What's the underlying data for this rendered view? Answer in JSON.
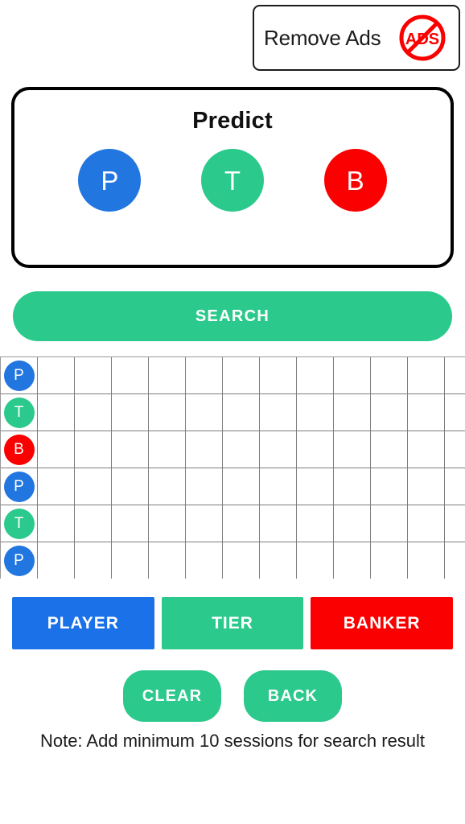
{
  "banner": {
    "label": "Remove Ads",
    "badge_icon": "no-ads-icon",
    "badge_text": "ADS",
    "badge_color": "#FB0000"
  },
  "predict": {
    "title": "Predict",
    "options": [
      {
        "letter": "P",
        "name": "player",
        "color": "#2176E0"
      },
      {
        "letter": "T",
        "name": "tier",
        "color": "#2BC98C"
      },
      {
        "letter": "B",
        "name": "banker",
        "color": "#FB0000"
      }
    ]
  },
  "search": {
    "label": "SEARCH",
    "color": "#2BC98C"
  },
  "grid": {
    "columns": 13,
    "rows": 6,
    "cells": [
      [
        "P",
        "",
        "",
        "",
        "",
        "",
        "",
        "",
        "",
        "",
        "",
        "",
        ""
      ],
      [
        "T",
        "",
        "",
        "",
        "",
        "",
        "",
        "",
        "",
        "",
        "",
        "",
        ""
      ],
      [
        "B",
        "",
        "",
        "",
        "",
        "",
        "",
        "",
        "",
        "",
        "",
        "",
        ""
      ],
      [
        "P",
        "",
        "",
        "",
        "",
        "",
        "",
        "",
        "",
        "",
        "",
        "",
        ""
      ],
      [
        "T",
        "",
        "",
        "",
        "",
        "",
        "",
        "",
        "",
        "",
        "",
        "",
        ""
      ],
      [
        "P",
        "",
        "",
        "",
        "",
        "",
        "",
        "",
        "",
        "",
        "",
        "",
        ""
      ]
    ],
    "marker_colors": {
      "P": "#2176E0",
      "T": "#2BC98C",
      "B": "#FB0000"
    }
  },
  "entry_buttons": [
    {
      "label": "PLAYER",
      "name": "player",
      "color": "#1B71E8"
    },
    {
      "label": "TIER",
      "name": "tier",
      "color": "#2BC98C"
    },
    {
      "label": "BANKER",
      "name": "banker",
      "color": "#FB0000"
    }
  ],
  "control_buttons": [
    {
      "label": "CLEAR",
      "name": "clear"
    },
    {
      "label": "BACK",
      "name": "back"
    }
  ],
  "note": {
    "text": "Note: Add minimum 10 sessions for search result"
  }
}
